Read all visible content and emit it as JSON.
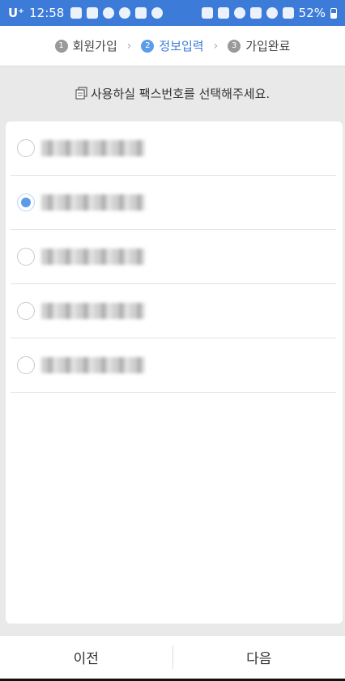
{
  "status_bar": {
    "carrier": "U⁺",
    "time": "12:58",
    "battery": "52%",
    "icons": [
      "mail-icon",
      "download-icon",
      "c-icon",
      "sync-icon",
      "pen-icon",
      "chat-icon",
      "call-icon",
      "image-icon",
      "alarm-icon",
      "mute-icon",
      "wifi-icon",
      "signal-icon",
      "battery-icon"
    ]
  },
  "steps": [
    {
      "num": "1",
      "label": "회원가입"
    },
    {
      "num": "2",
      "label": "정보입력"
    },
    {
      "num": "3",
      "label": "가입완료"
    }
  ],
  "instruction": "사용하실 팩스번호를 선택해주세요.",
  "options": [
    {
      "number": "0000-0000-0000",
      "selected": false
    },
    {
      "number": "0000-0000-0000",
      "selected": true
    },
    {
      "number": "0000-0000-0000",
      "selected": false
    },
    {
      "number": "0000-0000-0000",
      "selected": false
    },
    {
      "number": "0000-0000-0000",
      "selected": false
    }
  ],
  "buttons": {
    "prev": "이전",
    "next": "다음"
  },
  "colors": {
    "accent": "#3d7bd9",
    "radio_selected": "#5b9be8"
  }
}
